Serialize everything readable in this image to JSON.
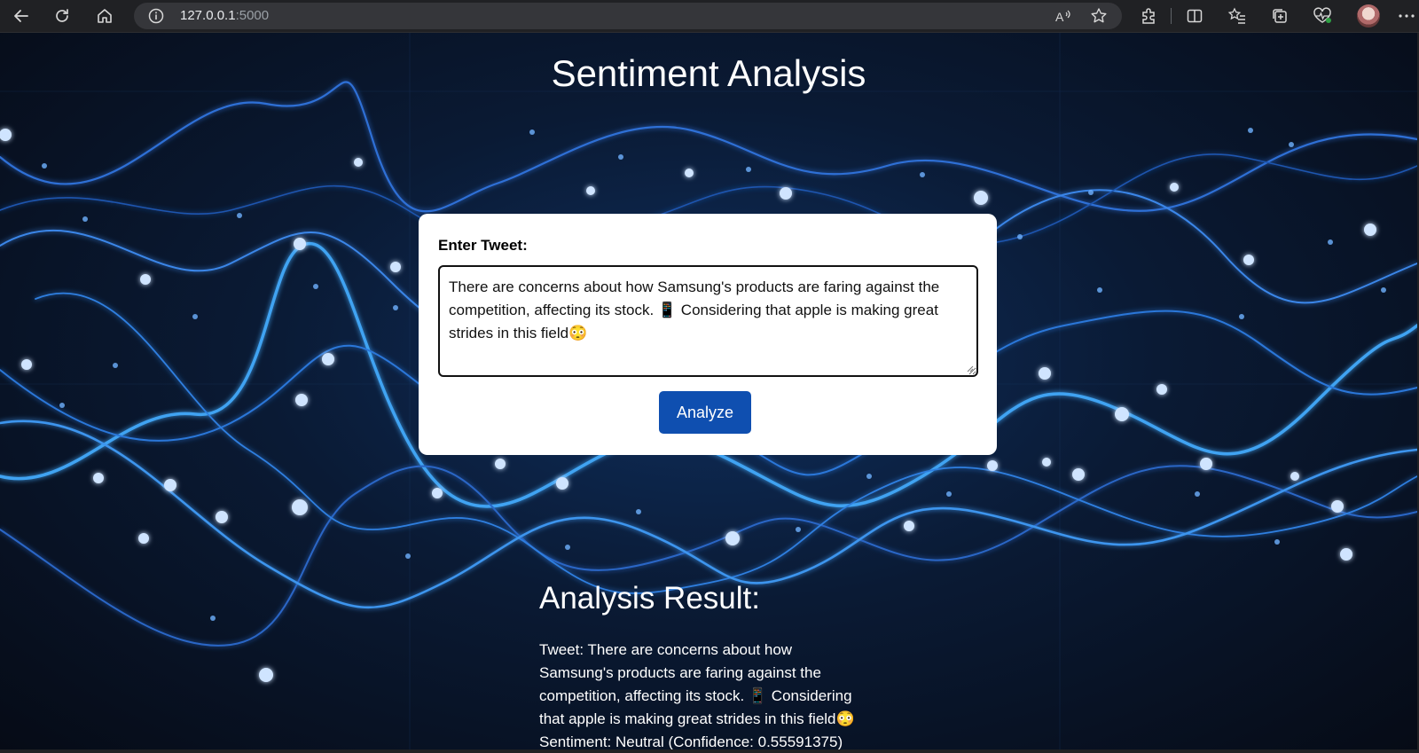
{
  "browser": {
    "url_host": "127.0.0.1",
    "url_port": ":5000"
  },
  "page": {
    "title": "Sentiment Analysis",
    "form": {
      "label": "Enter Tweet:",
      "tweet_value": "There are concerns about how Samsung's products are faring against the competition, affecting its stock. 📱 Considering that apple is making great strides in this field😳",
      "analyze_label": "Analyze"
    },
    "result": {
      "heading": "Analysis Result:",
      "tweet_line": "Tweet: There are concerns about how Samsung's products are faring against the competition, affecting its stock. 📱 Considering that apple is making great strides in this field😳",
      "sentiment_line": "Sentiment: Neutral (Confidence: 0.55591375)"
    }
  },
  "colors": {
    "accent_button": "#0f4fb0",
    "background": "#0a1a34"
  },
  "icons": {
    "back": "back-arrow-icon",
    "refresh": "refresh-icon",
    "home": "home-icon",
    "site_info": "info-icon",
    "read_aloud": "read-aloud-icon",
    "favorite": "star-icon",
    "extensions": "puzzle-icon",
    "split_screen": "split-screen-icon",
    "favorites": "favorites-list-icon",
    "collections": "collections-icon",
    "performance": "heart-pulse-icon",
    "more": "more-dots-icon"
  }
}
